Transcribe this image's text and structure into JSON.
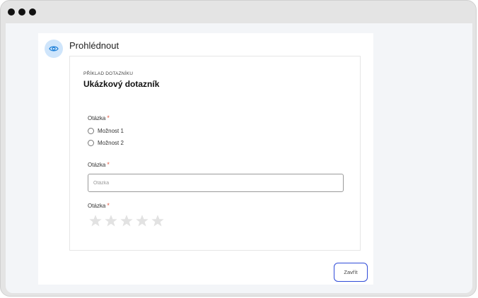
{
  "dialog": {
    "title": "Prohlédnout",
    "icon": "eye-icon"
  },
  "survey": {
    "kicker": "PŘÍKLAD DOTAZNÍKU",
    "title": "Ukázkový dotazník",
    "questions": [
      {
        "label": "Otázka",
        "required_mark": "*",
        "type": "radio",
        "options": [
          "Možnost 1",
          "Možnost 2"
        ]
      },
      {
        "label": "Otázka",
        "required_mark": "*",
        "type": "text",
        "placeholder": "Otázka",
        "value": ""
      },
      {
        "label": "Otázka",
        "required_mark": "*",
        "type": "rating",
        "max": 5,
        "value": 0
      }
    ]
  },
  "footer": {
    "close_label": "Zavřít"
  },
  "colors": {
    "accent": "#2f4bd8",
    "required": "#e2553f",
    "star_empty": "#e2e2e2",
    "icon_bg": "#cfe5fb",
    "icon_fg": "#1c7fd8"
  }
}
